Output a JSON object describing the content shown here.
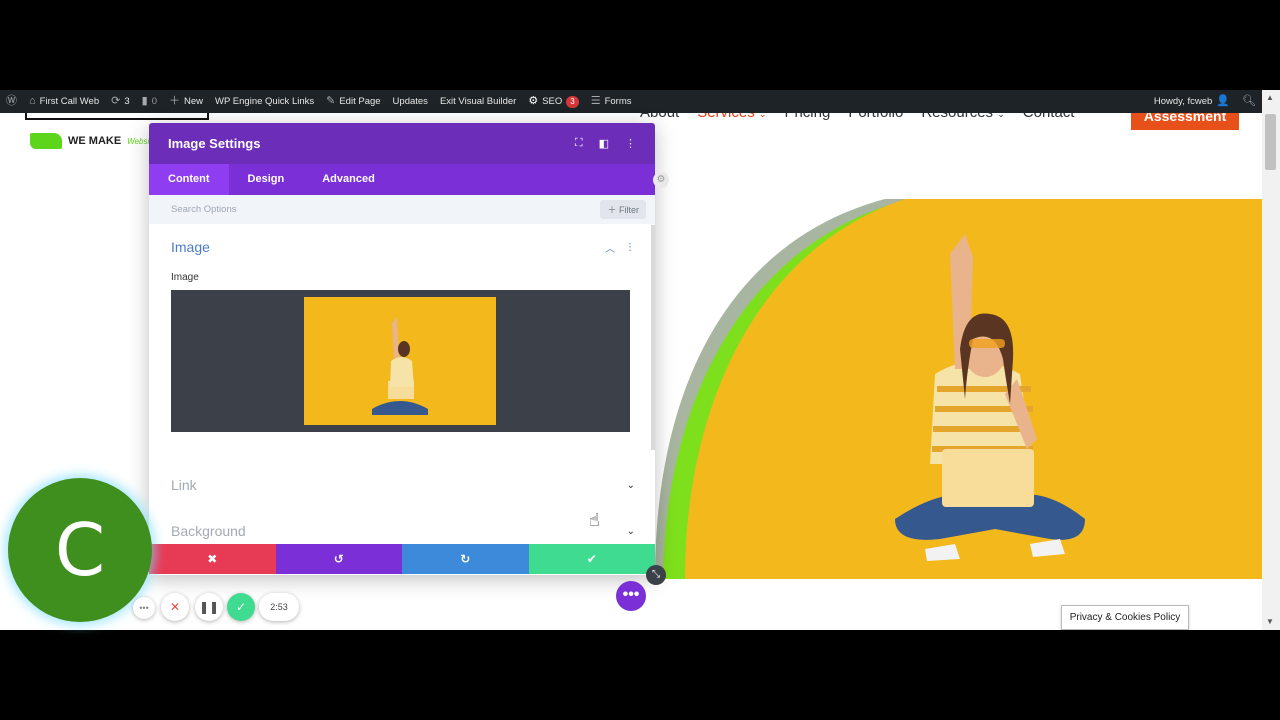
{
  "adminbar": {
    "site_name": "First Call Web",
    "updates_count": "3",
    "comments_count": "0",
    "new_label": "New",
    "wp_engine_label": "WP Engine Quick Links",
    "edit_page_label": "Edit Page",
    "updates_label": "Updates",
    "exit_builder_label": "Exit Visual Builder",
    "seo_label": "SEO",
    "seo_badge": "3",
    "forms_label": "Forms",
    "howdy_label": "Howdy, fcweb"
  },
  "site": {
    "nav": [
      "About",
      "Services",
      "Pricing",
      "Portfolio",
      "Resources",
      "Contact"
    ],
    "cta_label": "Assessment",
    "logo_text": "WE MAKE",
    "logo_script": "Website"
  },
  "panel": {
    "title": "Image Settings",
    "tabs": [
      "Content",
      "Design",
      "Advanced"
    ],
    "search_placeholder": "Search Options",
    "filter_label": "Filter",
    "section_image_title": "Image",
    "image_field_label": "Image",
    "section_link_title": "Link",
    "section_background_title": "Background"
  },
  "actions": {
    "cancel": "✖",
    "undo": "↺",
    "redo": "↻",
    "save": "✔"
  },
  "recorder": {
    "avatar_letter": "C",
    "timer": "2:53"
  },
  "privacy_label": "Privacy & Cookies Policy",
  "colors": {
    "panel_header": "#6c2eb9",
    "panel_tabs": "#7b2fd6",
    "cancel": "#e73b55",
    "undo": "#7b2fd6",
    "redo": "#3c8ad9",
    "save": "#3fdb91",
    "hero_yellow": "#f2b81c"
  }
}
